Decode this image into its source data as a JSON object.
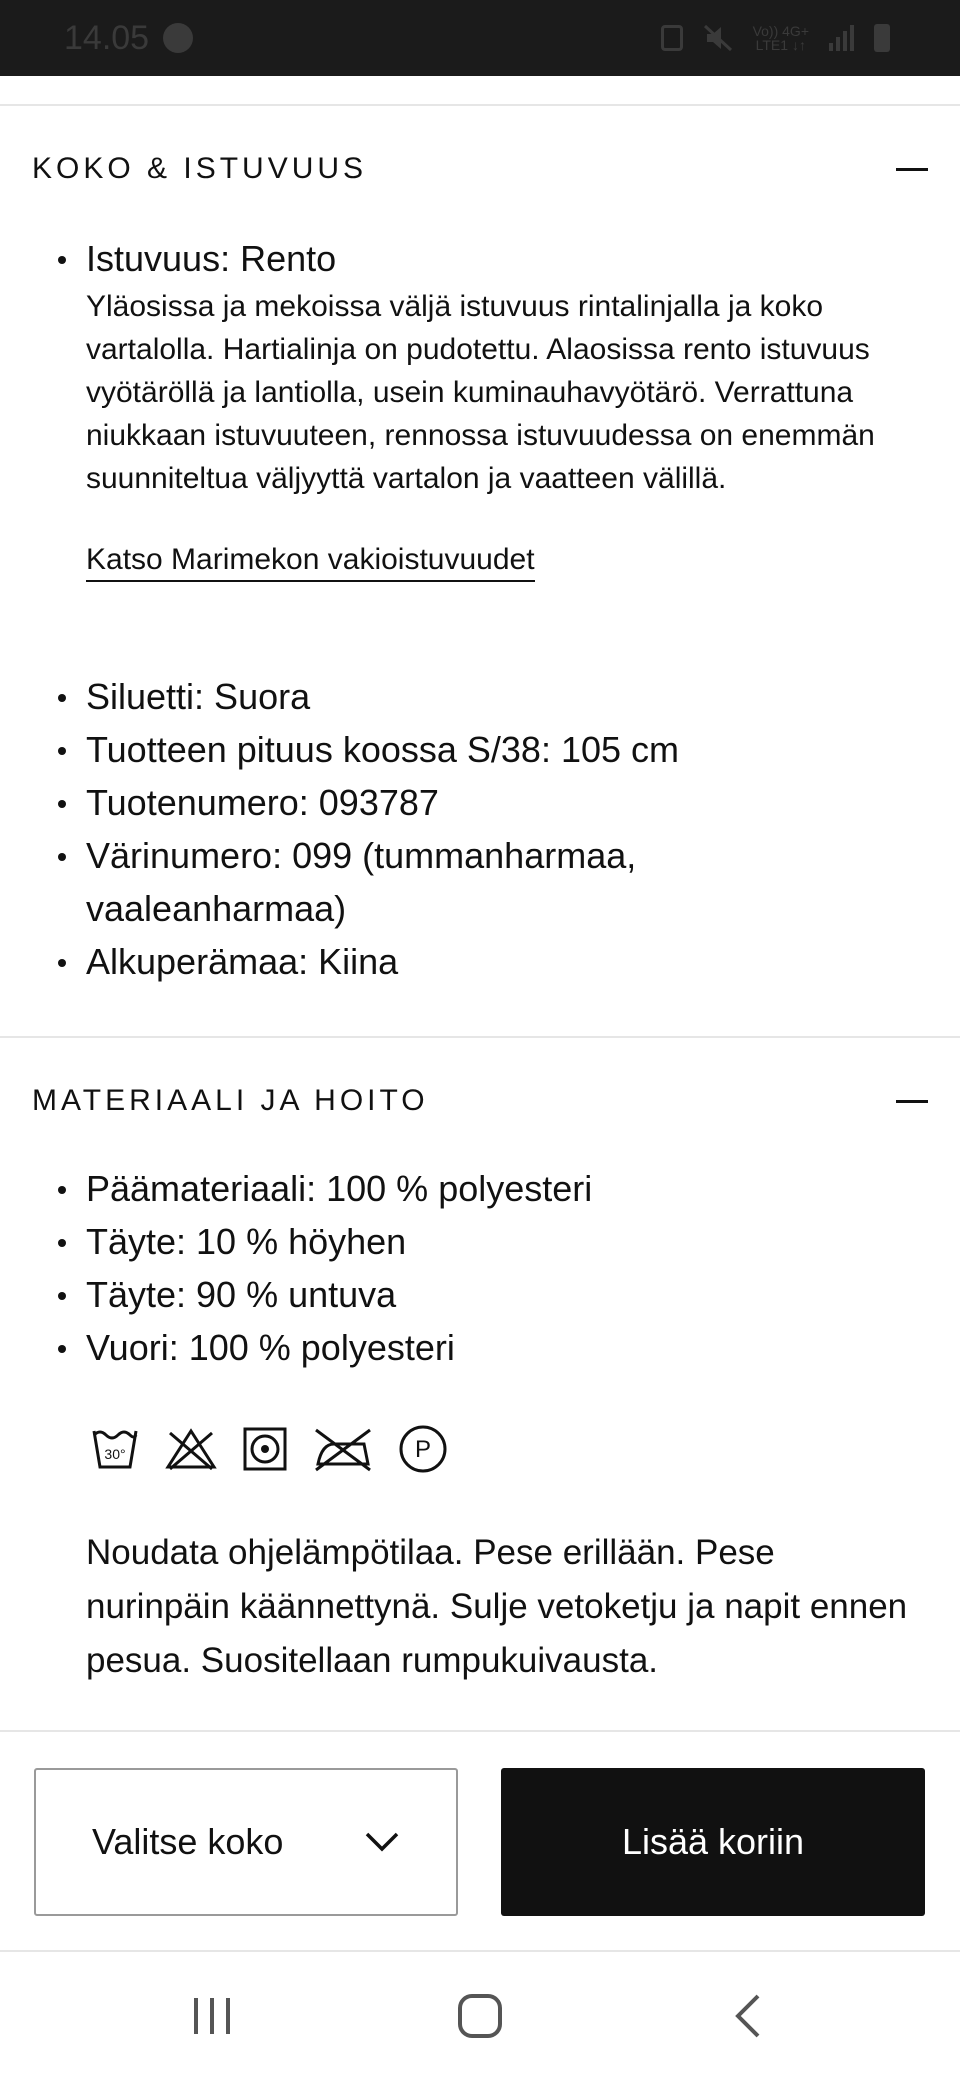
{
  "status_bar": {
    "time": "14.05",
    "network_top": "Vo)) 4G+",
    "network_bottom": "LTE1 ↓↑"
  },
  "fit_section": {
    "title": "KOKO & ISTUVUUS",
    "fit_label": "Istuvuus: Rento",
    "fit_description": "Yläosissa ja mekoissa väljä istuvuus rintalinjalla ja koko vartalolla. Hartialinja on pudotettu. Alaosissa rento istuvuus vyötäröllä ja lantiolla, usein kuminauhavyötärö. Verrattuna niukkaan istuvuuteen, rennossa istuvuudessa on enemmän suunniteltua väljyyttä vartalon ja vaatteen välillä.",
    "fit_link": "Katso Marimekon vakioistuvuudet",
    "details": [
      "Siluetti: Suora",
      "Tuotteen pituus koossa S/38: 105 cm",
      "Tuotenumero: 093787",
      "Värinumero: 099 (tummanharmaa, vaaleanharmaa)",
      "Alkuperämaa: Kiina"
    ]
  },
  "material_section": {
    "title": "MATERIAALI JA HOITO",
    "materials": [
      "Päämateriaali: 100 % polyesteri",
      "Täyte: 10 % höyhen",
      "Täyte: 90 % untuva",
      "Vuori: 100 % polyesteri"
    ],
    "care_icons": [
      "wash-30-icon",
      "no-bleach-icon",
      "tumble-dry-icon",
      "no-iron-icon",
      "dry-clean-p-icon"
    ],
    "wash_temp": "30°",
    "dry_clean_letter": "P",
    "care_text": "Noudata ohjelämpötilaa. Pese erillään. Pese nurinpäin käännettynä. Sulje vetoketju ja napit ennen pesua. Suositellaan rumpukuivausta."
  },
  "bottom_bar": {
    "size_select_label": "Valitse koko",
    "add_to_cart_label": "Lisää koriin"
  },
  "colors": {
    "text": "#111111",
    "button_bg": "#111111",
    "divider": "#e6e6e6",
    "status_bar": "#1b1b1b"
  }
}
